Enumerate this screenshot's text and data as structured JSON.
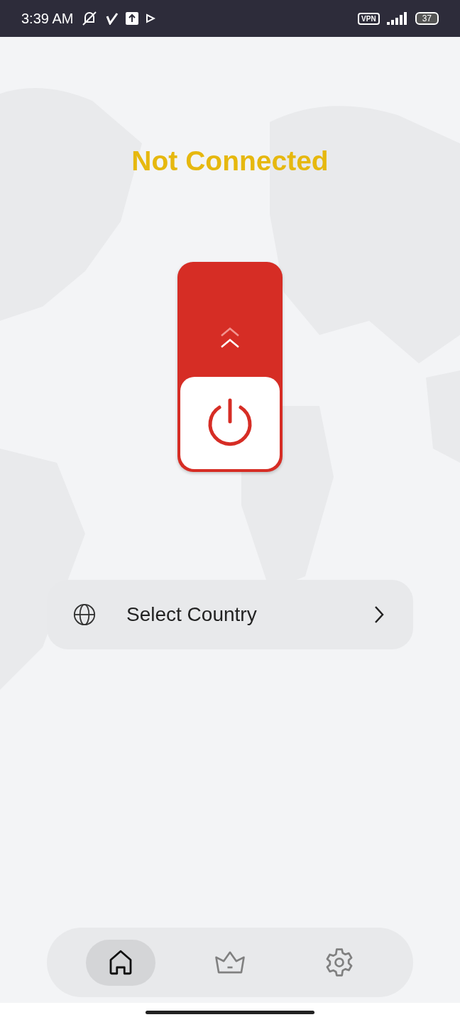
{
  "status_bar": {
    "time": "3:39 AM",
    "vpn_badge": "VPN",
    "battery": "37"
  },
  "status_title": "Not Connected",
  "power_switch": {
    "connected": false
  },
  "country_selector": {
    "label": "Select Country"
  },
  "nav": [
    {
      "kind": "home",
      "selected": true
    },
    {
      "kind": "premium",
      "selected": false
    },
    {
      "kind": "settings",
      "selected": false
    }
  ]
}
